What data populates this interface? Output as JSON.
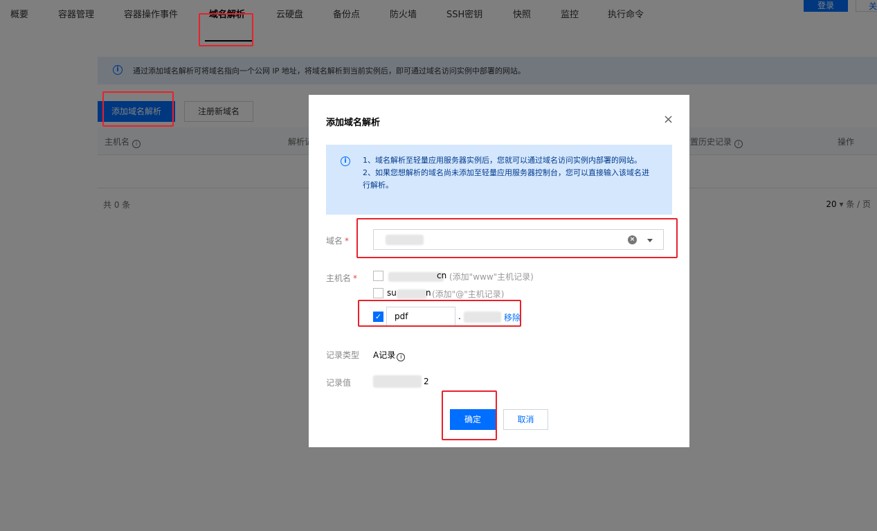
{
  "header": {
    "login_button": "登录",
    "secondary_button": "关",
    "tabs": [
      {
        "label": "概要"
      },
      {
        "label": "容器管理"
      },
      {
        "label": "容器操作事件"
      },
      {
        "label": "域名解析",
        "active": true
      },
      {
        "label": "云硬盘"
      },
      {
        "label": "备份点"
      },
      {
        "label": "防火墙"
      },
      {
        "label": "SSH密钥"
      },
      {
        "label": "快照"
      },
      {
        "label": "监控"
      },
      {
        "label": "执行命令"
      }
    ]
  },
  "page": {
    "info_text": "通过添加域名解析可将域名指向一个公网 IP 地址，将域名解析到当前实例后，即可通过域名访问实例中部署的网站。",
    "add_button": "添加域名解析",
    "register_button": "注册新域名",
    "table": {
      "columns": [
        "主机名",
        "解析记",
        "置历史记录",
        "操作"
      ]
    },
    "total": "共 0 条",
    "page_size": "20",
    "page_size_unit": "条 / 页"
  },
  "modal": {
    "title": "添加域名解析",
    "notice_line1": "1、域名解析至轻量应用服务器实例后，您就可以通过域名访问实例内部署的网站。",
    "notice_line2": "2、如果您想解析的域名尚未添加至轻量应用服务器控制台，您可以直接输入该域名进行解析。",
    "domain_label": "域名",
    "host_label": "主机名",
    "host_options": [
      {
        "text_suffix": "cn",
        "hint": "(添加\"www\"主机记录)",
        "checked": false
      },
      {
        "text_prefix": "su",
        "text_suffix": "n",
        "hint": "(添加\"@\"主机记录)",
        "checked": false
      }
    ],
    "custom_host_value": "pdf",
    "custom_host_separator": ".",
    "remove_link": "移除",
    "record_type_label": "记录类型",
    "record_type_value": "A记录",
    "record_value_label": "记录值",
    "record_value_suffix": "2",
    "confirm_button": "确定",
    "cancel_button": "取消"
  },
  "colors": {
    "primary": "#006eff",
    "annotation": "#e8212b",
    "notice_bg": "#d5e7fd"
  }
}
